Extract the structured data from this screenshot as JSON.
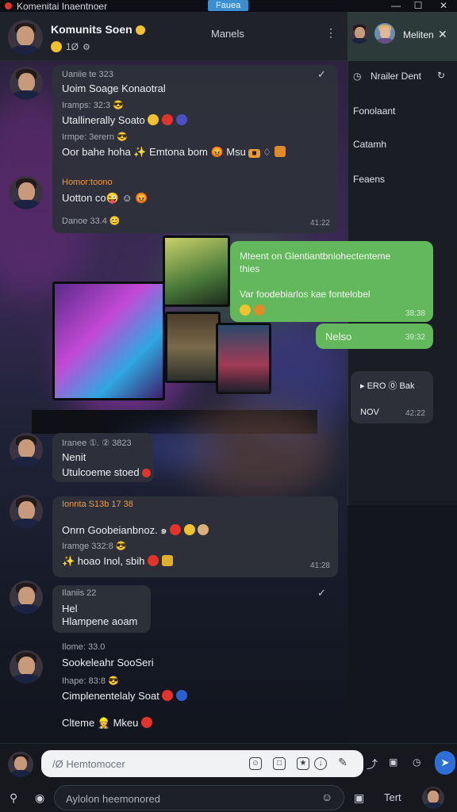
{
  "window": {
    "title": "Komenitai Inaentnoer",
    "badge": "Fauea",
    "controls": [
      "—",
      "☐",
      "✕"
    ]
  },
  "header": {
    "title": "Komunits Soen",
    "subtitle_count": "1Ø",
    "center_label": "Manels",
    "more_icon": "more-icon"
  },
  "right_panel": {
    "title": "Meliten",
    "items": [
      "Nrailer Dent",
      "Fonolaant",
      "Catamh",
      "Feaens"
    ]
  },
  "messages": [
    {
      "id": "m1",
      "lines": [
        {
          "kind": "meta",
          "text": "Uaniie te 323"
        },
        {
          "kind": "text",
          "text": "Uoim Soage Konaotral"
        },
        {
          "kind": "meta",
          "text": "Iramps: 32:3 😎"
        },
        {
          "kind": "text",
          "text": "Utallinerally Soato"
        },
        {
          "kind": "meta",
          "text": "Irmpe: 3erern 😎"
        },
        {
          "kind": "text",
          "text": "Oor bahe hoha ✨ Emtona bom 😡 Msu"
        },
        {
          "kind": "name",
          "text": "Homor:toono"
        },
        {
          "kind": "text",
          "text": "Uotton co😜 ☺ 😡"
        },
        {
          "kind": "meta",
          "text": "Danoe 33.4 😊"
        }
      ],
      "time": "41:22"
    },
    {
      "id": "m2",
      "lines": [
        {
          "kind": "text",
          "text": "Mteent on Glentiantbnlohectenteme"
        },
        {
          "kind": "text",
          "text": "thies"
        },
        {
          "kind": "text",
          "text": "Var foodebiarlos kae fontelobel"
        }
      ],
      "time": "38:38"
    },
    {
      "id": "m3",
      "lines": [
        {
          "kind": "text",
          "text": "Nelso"
        }
      ],
      "time": "39:32"
    },
    {
      "id": "m4",
      "lines": [
        {
          "kind": "text",
          "text": "▸ ERO ⓪ Bak"
        },
        {
          "kind": "text",
          "text": "NOV"
        }
      ],
      "time": "42:22"
    },
    {
      "id": "m5",
      "lines": [
        {
          "kind": "meta",
          "text": "Iranee ①. ② 3823"
        },
        {
          "kind": "text",
          "text": "Nenit"
        },
        {
          "kind": "text",
          "text": "Utulcoeme stoed"
        }
      ],
      "time": ""
    },
    {
      "id": "m6",
      "lines": [
        {
          "kind": "name",
          "text": "Ionnta S13b 17 38"
        },
        {
          "kind": "text",
          "text": "Onrn Goobeianbnoz. ๑"
        },
        {
          "kind": "meta",
          "text": "Iramge 332:8 😎"
        },
        {
          "kind": "text",
          "text": "✨ hoao Inol, sbih"
        }
      ],
      "time": "41:28"
    },
    {
      "id": "m7",
      "lines": [
        {
          "kind": "meta",
          "text": "Ilaniis 22"
        },
        {
          "kind": "text",
          "text": "Hel"
        },
        {
          "kind": "text",
          "text": "Hlampene aoam"
        }
      ],
      "time": ""
    },
    {
      "id": "m8",
      "lines": [
        {
          "kind": "meta",
          "text": "Ilome: 33.0"
        },
        {
          "kind": "text",
          "text": "Sookeleahr SooSeri"
        },
        {
          "kind": "meta",
          "text": "Ihape: 83:8 😎"
        },
        {
          "kind": "text",
          "text": "Cimplenentelaly Soat"
        },
        {
          "kind": "text",
          "text": "Clteme 👷 Mkeu"
        }
      ],
      "time": ""
    }
  ],
  "composer": {
    "placeholder_main": "/Ø Hemtomocer",
    "placeholder_secondary": "Aylolon heemonored",
    "right_label": "Tert"
  },
  "colors": {
    "accent_green": "#62b85b",
    "accent_blue": "#2d6fd6",
    "bubble_dark": "#2e313a",
    "name_orange": "#e89a4a"
  }
}
